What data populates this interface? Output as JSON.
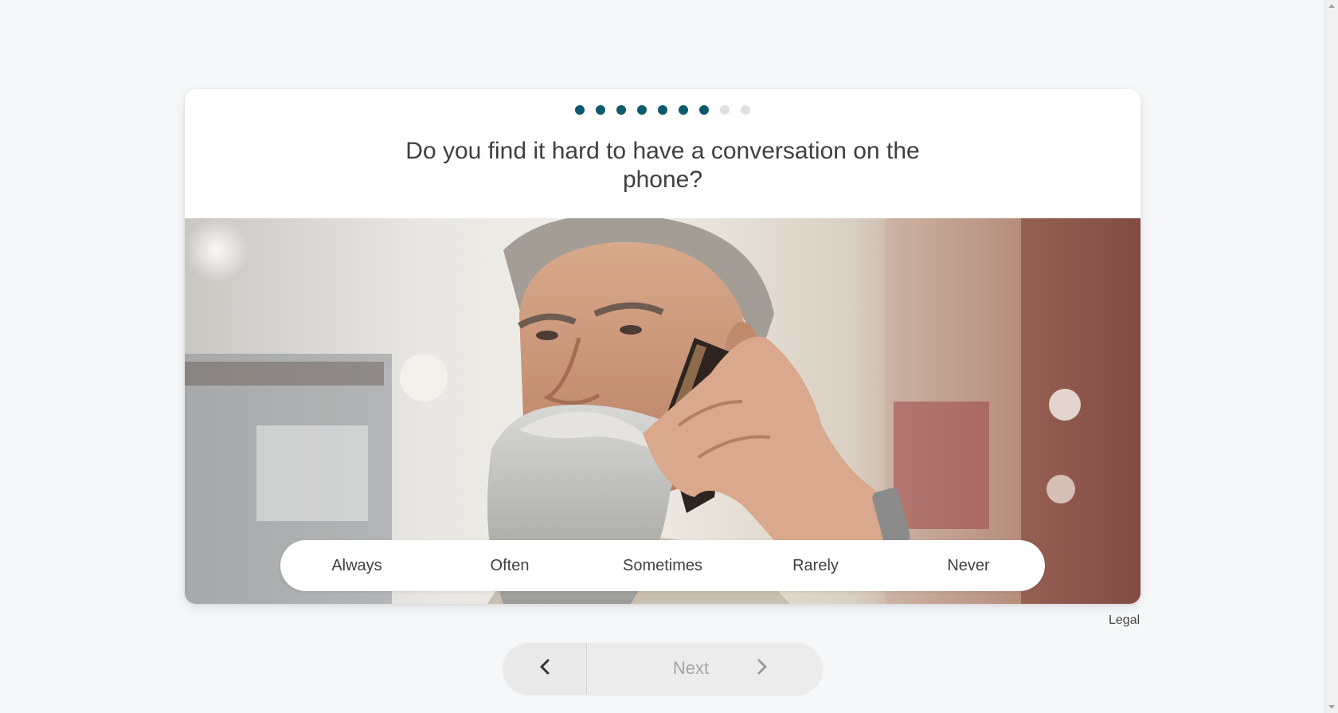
{
  "progress": {
    "total_steps": 9,
    "completed_steps": 7,
    "active_color": "#0d5a6c",
    "inactive_color": "#e0e0e0"
  },
  "question": {
    "text": "Do you find it hard to have a conversation on the phone?"
  },
  "photo": {
    "icon": "photo-man-on-phone"
  },
  "answers": {
    "options": [
      "Always",
      "Often",
      "Sometimes",
      "Rarely",
      "Never"
    ]
  },
  "footer": {
    "legal_label": "Legal"
  },
  "navigation": {
    "back_icon": "chevron-left-icon",
    "next_label": "Next",
    "next_icon": "chevron-right-icon"
  }
}
